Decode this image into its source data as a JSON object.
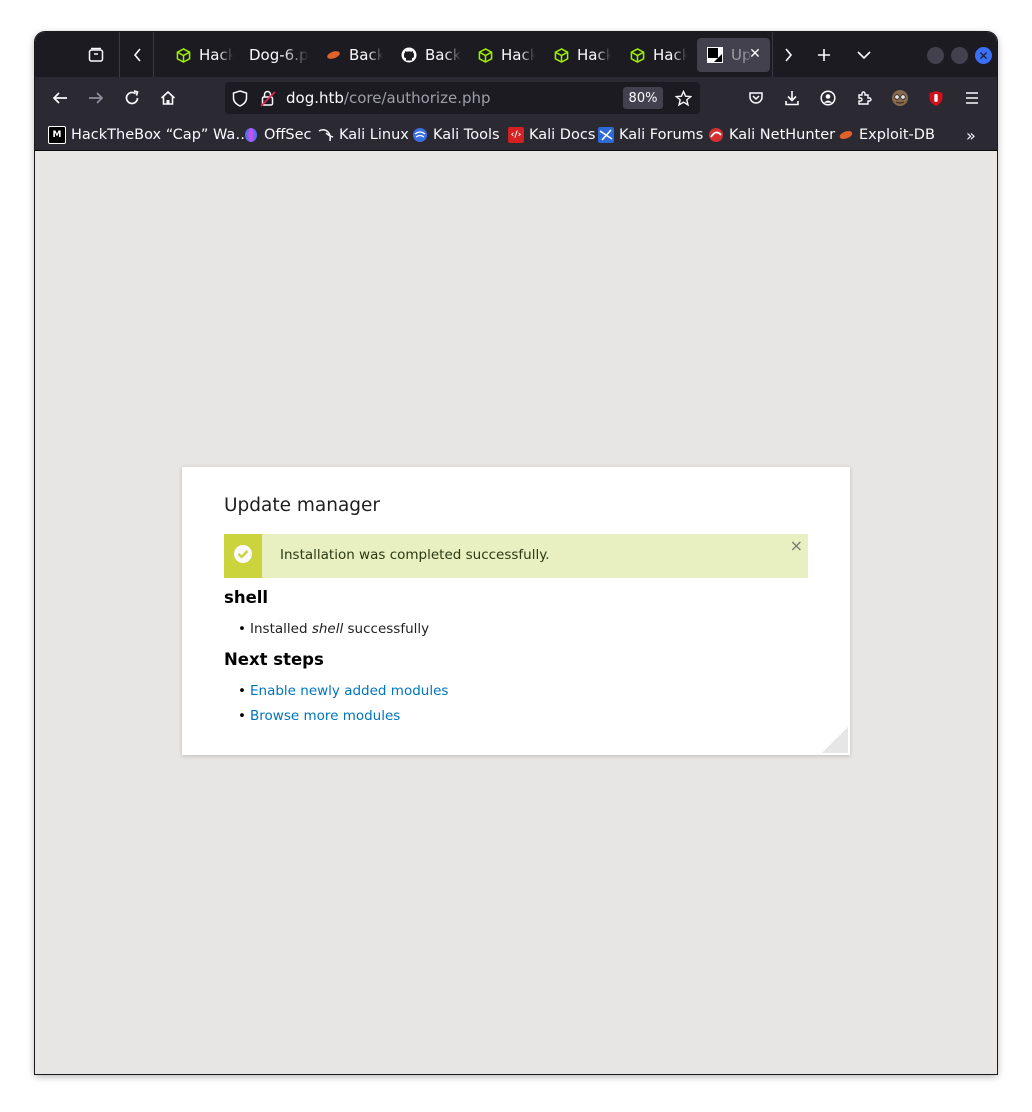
{
  "browser": {
    "tabs": [
      {
        "label": "Hack",
        "icon": "htb-cube-icon",
        "active": false
      },
      {
        "label": "Dog-6.p",
        "icon": "none",
        "active": false
      },
      {
        "label": "Back",
        "icon": "backdrop-icon",
        "active": false
      },
      {
        "label": "Back",
        "icon": "github-icon",
        "active": false
      },
      {
        "label": "Hack",
        "icon": "htb-cube-icon",
        "active": false
      },
      {
        "label": "Hack",
        "icon": "htb-cube-icon",
        "active": false
      },
      {
        "label": "Hack",
        "icon": "htb-cube-icon",
        "active": false
      },
      {
        "label": "Up",
        "icon": "backdrop-drop-icon",
        "active": true
      }
    ],
    "url": {
      "host": "dog.htb",
      "path": "/core/authorize.php"
    },
    "zoom": "80%",
    "bookmarks": [
      {
        "label": "HackTheBox “Cap” Wa…",
        "icon": "medium-icon"
      },
      {
        "label": "OffSec",
        "icon": "offsec-icon"
      },
      {
        "label": "Kali Linux",
        "icon": "kali-dragon-icon"
      },
      {
        "label": "Kali Tools",
        "icon": "kali-tools-icon"
      },
      {
        "label": "Kali Docs",
        "icon": "kali-docs-icon"
      },
      {
        "label": "Kali Forums",
        "icon": "kali-forums-icon"
      },
      {
        "label": "Kali NetHunter",
        "icon": "nethunter-icon"
      },
      {
        "label": "Exploit-DB",
        "icon": "exploitdb-icon"
      }
    ],
    "accent_color": "#3a6ff7"
  },
  "page": {
    "title": "Update manager",
    "message": "Installation was completed successfully.",
    "message_close": "×",
    "project_heading": "shell",
    "project_item_prefix": "Installed ",
    "project_item_name": "shell",
    "project_item_suffix": " successfully",
    "next_heading": "Next steps",
    "next_links": [
      "Enable newly added modules",
      "Browse more modules"
    ],
    "link_color": "#0074bd",
    "success_color": "#cbd43c"
  }
}
